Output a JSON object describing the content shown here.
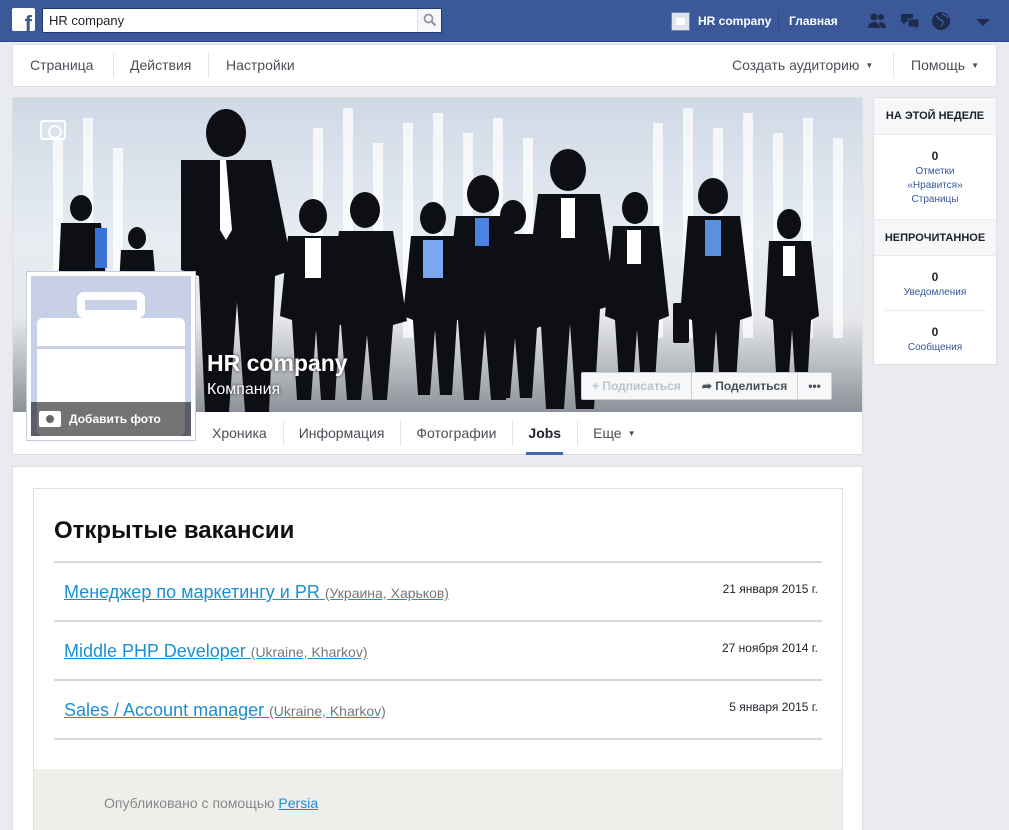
{
  "topbar": {
    "search_value": "HR company",
    "profile_name": "HR company",
    "home_label": "Главная",
    "icons": [
      "friends-icon",
      "messages-icon",
      "notifications-globe-icon",
      "account-menu-icon"
    ]
  },
  "adminbar": {
    "page": "Страница",
    "actions": "Действия",
    "settings": "Настройки",
    "create_audience": "Создать аудиторию",
    "help": "Помощь"
  },
  "header": {
    "page_name": "HR company",
    "category": "Компания",
    "add_photo": "Добавить фото",
    "subscribe": "Подписаться",
    "share": "Поделиться",
    "more": "•••"
  },
  "tabs": [
    {
      "label": "Хроника"
    },
    {
      "label": "Информация"
    },
    {
      "label": "Фотографии"
    },
    {
      "label": "Jobs",
      "active": true
    },
    {
      "label": "Еще"
    }
  ],
  "right": {
    "this_week_title": "НА ЭТОЙ НЕДЕЛЕ",
    "likes_count": "0",
    "likes_label_1": "Отметки",
    "likes_label_2": "«Нравится»",
    "likes_label_3": "Страницы",
    "unread_title": "НЕПРОЧИТАННОЕ",
    "notif_count": "0",
    "notif_label": "Уведомления",
    "msg_count": "0",
    "msg_label": "Сообщения"
  },
  "jobs": {
    "title": "Открытые вакансии",
    "items": [
      {
        "title": "Менеджер по маркетингу и PR",
        "location": "(Украина, Харьков)",
        "date": "21 января 2015 г."
      },
      {
        "title": "Middle PHP Developer",
        "location": "(Ukraine, Kharkov)",
        "date": "27 ноября 2014 г."
      },
      {
        "title": "Sales / Account manager",
        "location": "(Ukraine, Kharkov)",
        "date": "5 января 2015 г."
      }
    ],
    "footer_text": "Опубликовано с помощью",
    "footer_link": "Persia"
  },
  "colors": {
    "topbar": "#3b5998",
    "link": "#1a8fd3",
    "tab_underline": "#4267b2"
  }
}
